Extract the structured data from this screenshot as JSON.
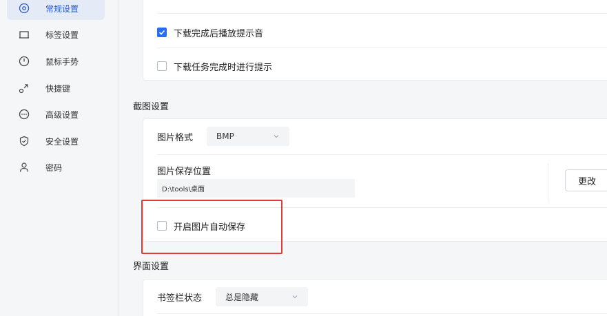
{
  "sidebar": {
    "items": [
      {
        "label": "常规设置",
        "icon": "target-icon",
        "active": true
      },
      {
        "label": "标签设置",
        "icon": "tab-icon",
        "active": false
      },
      {
        "label": "鼠标手势",
        "icon": "gesture-icon",
        "active": false
      },
      {
        "label": "快捷键",
        "icon": "shortcut-icon",
        "active": false
      },
      {
        "label": "高级设置",
        "icon": "more-icon",
        "active": false
      },
      {
        "label": "安全设置",
        "icon": "shield-icon",
        "active": false
      },
      {
        "label": "密码",
        "icon": "user-icon",
        "active": false
      }
    ]
  },
  "download": {
    "opt_play_sound": {
      "label": "下载完成后播放提示音",
      "checked": true
    },
    "opt_task_notify": {
      "label": "下载任务完成时进行提示",
      "checked": false
    }
  },
  "screenshot": {
    "section_title": "截图设置",
    "format_label": "图片格式",
    "format_value": "BMP",
    "save_location_label": "图片保存位置",
    "save_path": "D:\\tools\\桌面",
    "change_button": "更改",
    "auto_save": {
      "label": "开启图片自动保存",
      "checked": false
    }
  },
  "ui": {
    "section_title": "界面设置",
    "bookmark_bar_label": "书签栏状态",
    "bookmark_bar_value": "总是隐藏"
  },
  "colors": {
    "accent": "#2a6ef0",
    "active_nav_bg": "#e4ebf7",
    "highlight": "#e53935"
  }
}
